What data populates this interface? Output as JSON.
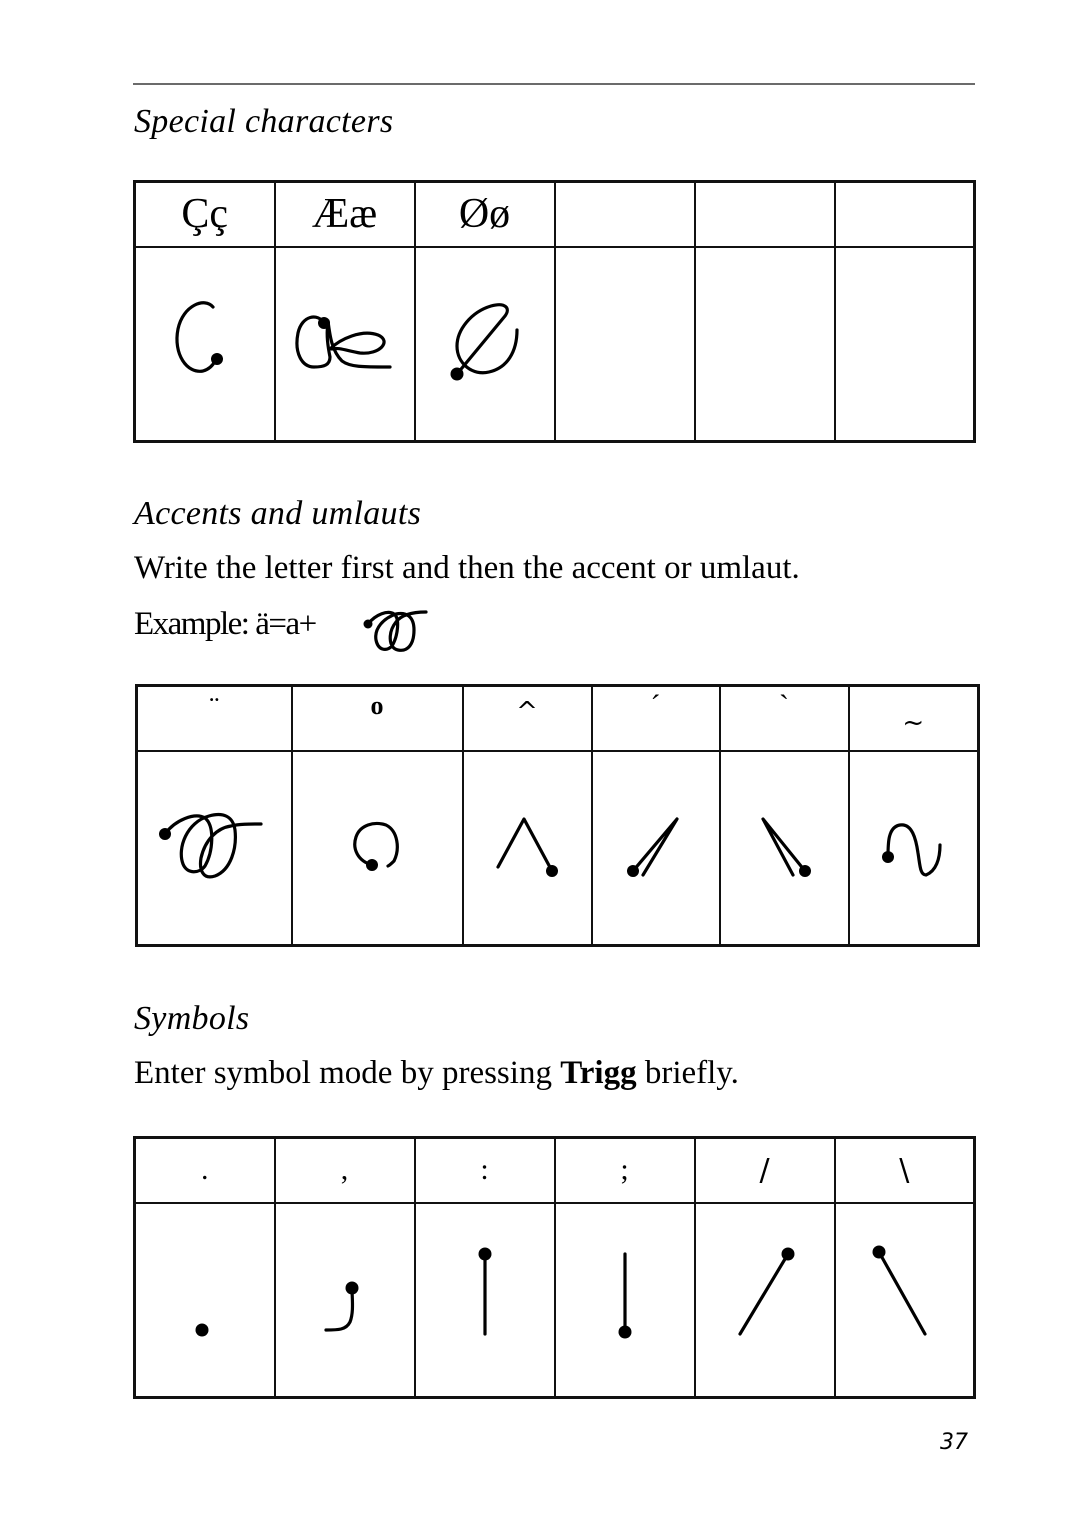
{
  "page": {
    "number": "37"
  },
  "special_characters": {
    "title": "Special characters",
    "headers": [
      "Çç",
      "Ææ",
      "Øø",
      "",
      "",
      ""
    ],
    "strokes": [
      "c-cedilla-stroke",
      "ae-stroke",
      "o-slash-stroke",
      "",
      "",
      ""
    ]
  },
  "accents": {
    "title": "Accents and umlauts",
    "instruction": "Write the letter first and then the accent or umlaut.",
    "example_label": "Example: ä=a+",
    "headers": [
      "¨",
      "o",
      "^",
      "´",
      "`",
      "~"
    ],
    "strokes": [
      "umlaut-stroke",
      "ring-stroke",
      "circumflex-stroke",
      "acute-stroke",
      "grave-stroke",
      "tilde-stroke"
    ]
  },
  "symbols": {
    "title": "Symbols",
    "instruction_before": "Enter symbol mode by pressing ",
    "instruction_key": "Trigg",
    "instruction_after": " briefly.",
    "headers": [
      ".",
      ",",
      ":",
      ";",
      "/",
      "\\"
    ],
    "strokes": [
      "period-stroke",
      "comma-stroke",
      "colon-stroke",
      "semicolon-stroke",
      "slash-stroke",
      "backslash-stroke"
    ]
  }
}
